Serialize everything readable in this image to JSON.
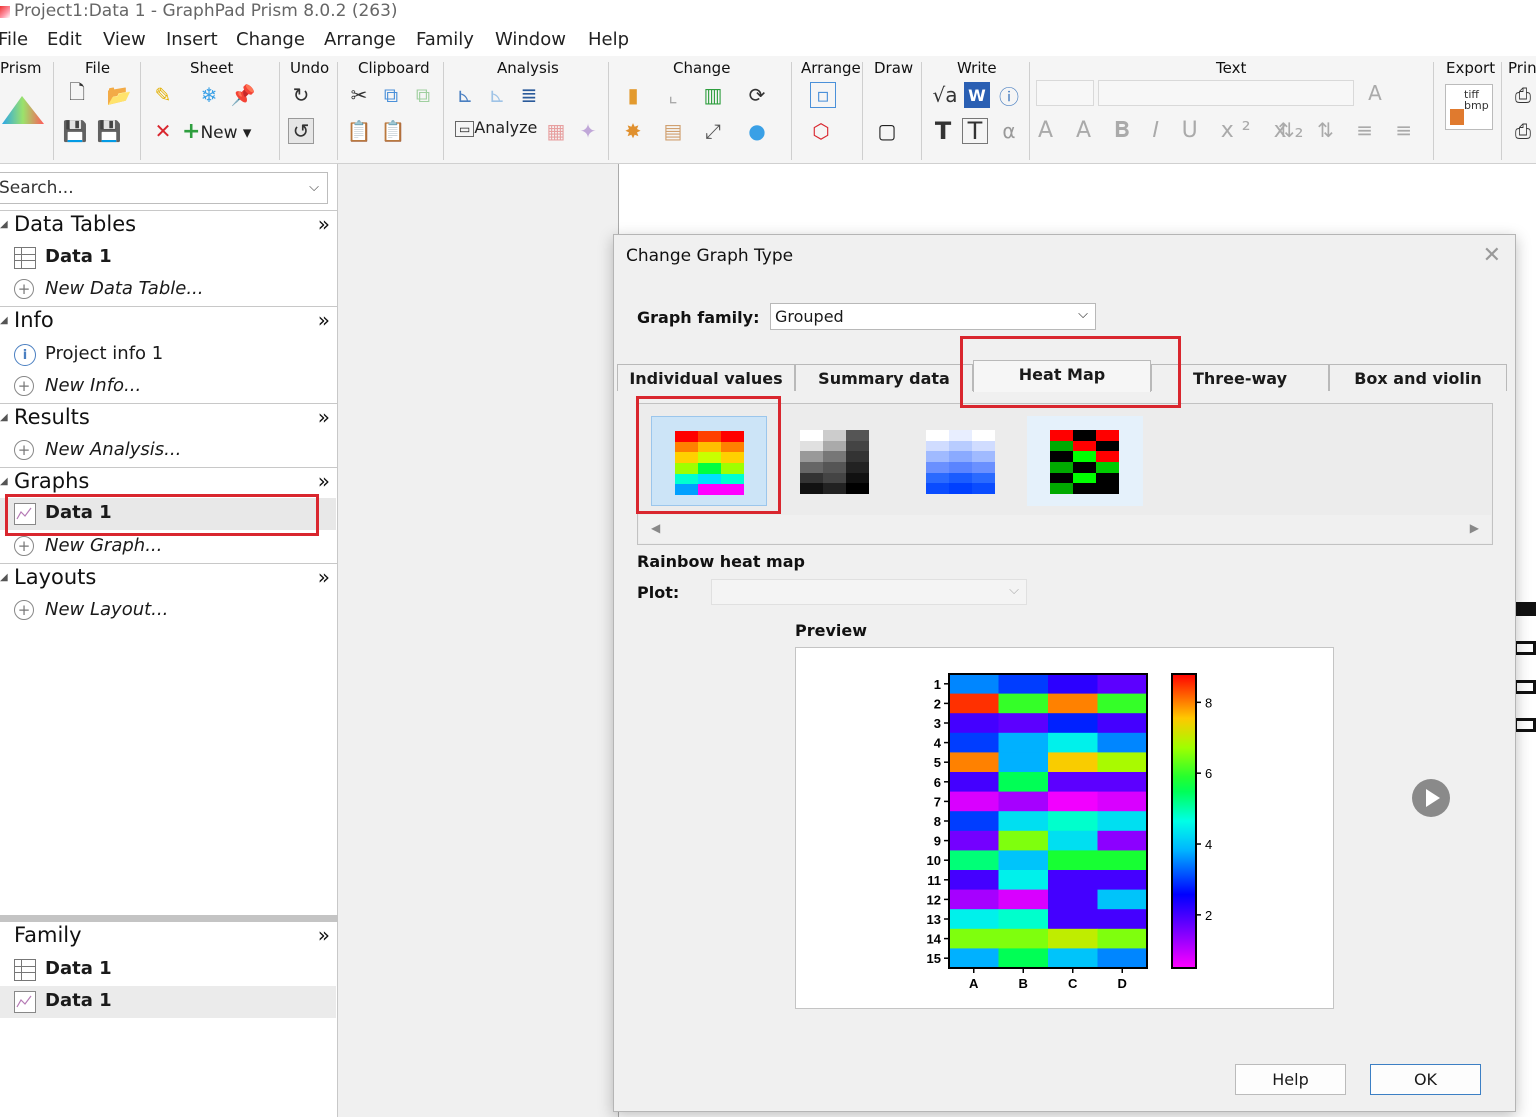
{
  "app": {
    "title": "Project1:Data 1 - GraphPad Prism 8.0.2 (263)",
    "menu": [
      "File",
      "Edit",
      "View",
      "Insert",
      "Change",
      "Arrange",
      "Family",
      "Window",
      "Help"
    ]
  },
  "ribbon": {
    "groups": [
      "Prism",
      "File",
      "Sheet",
      "Undo",
      "Clipboard",
      "Analysis",
      "Change",
      "Arrange",
      "Draw",
      "Write",
      "Text",
      "Export",
      "Print"
    ],
    "new_label": "New",
    "analyze_label": "Analyze",
    "export_icon_text": "tiff bmp"
  },
  "navigator": {
    "search_placeholder": "Search...",
    "sections": {
      "data_tables": {
        "title": "Data Tables",
        "items": [
          "Data 1"
        ],
        "new": "New Data Table..."
      },
      "info": {
        "title": "Info",
        "items": [
          "Project info 1"
        ],
        "new": "New Info..."
      },
      "results": {
        "title": "Results",
        "new": "New Analysis..."
      },
      "graphs": {
        "title": "Graphs",
        "items": [
          "Data 1"
        ],
        "new": "New Graph..."
      },
      "layouts": {
        "title": "Layouts",
        "new": "New Layout..."
      }
    },
    "more_glyph": "»",
    "family": {
      "title": "Family",
      "items": [
        "Data 1",
        "Data 1"
      ]
    }
  },
  "dialog": {
    "title": "Change Graph Type",
    "graph_family_label": "Graph family:",
    "graph_family_value": "Grouped",
    "tabs": [
      "Individual values",
      "Summary data",
      "Heat Map",
      "Three-way",
      "Box and violin"
    ],
    "active_tab": "Heat Map",
    "selected_type": "Rainbow heat map",
    "plot_label": "Plot:",
    "plot_value": "",
    "preview_label": "Preview",
    "help_button": "Help",
    "ok_button": "OK"
  },
  "chart_data": {
    "type": "heatmap",
    "rows": [
      "1",
      "2",
      "3",
      "4",
      "5",
      "6",
      "7",
      "8",
      "9",
      "10",
      "11",
      "12",
      "13",
      "14",
      "15"
    ],
    "columns": [
      "A",
      "B",
      "C",
      "D"
    ],
    "values": [
      [
        3.5,
        3.0,
        2.2,
        1.8
      ],
      [
        8.5,
        6.0,
        8.0,
        6.0
      ],
      [
        2.0,
        1.8,
        2.8,
        2.0
      ],
      [
        3.0,
        3.8,
        4.5,
        3.5
      ],
      [
        8.0,
        3.8,
        7.5,
        6.8
      ],
      [
        2.0,
        5.5,
        1.8,
        1.8
      ],
      [
        0.8,
        1.2,
        0.6,
        0.8
      ],
      [
        3.0,
        4.3,
        4.8,
        4.3
      ],
      [
        1.6,
        6.5,
        4.3,
        1.4
      ],
      [
        5.3,
        4.0,
        5.8,
        5.8
      ],
      [
        2.0,
        4.5,
        2.0,
        2.0
      ],
      [
        1.2,
        0.8,
        2.0,
        4.0
      ],
      [
        4.5,
        4.8,
        2.0,
        2.0
      ],
      [
        6.5,
        6.5,
        7.0,
        6.5
      ],
      [
        3.8,
        5.5,
        4.0,
        3.5
      ]
    ],
    "colorbar_ticks": [
      2,
      4,
      6,
      8
    ],
    "color_range": [
      0.5,
      8.8
    ],
    "colormap": "rainbow"
  },
  "colors": {
    "highlight": "#d9262e",
    "selection": "#cce4f7"
  }
}
